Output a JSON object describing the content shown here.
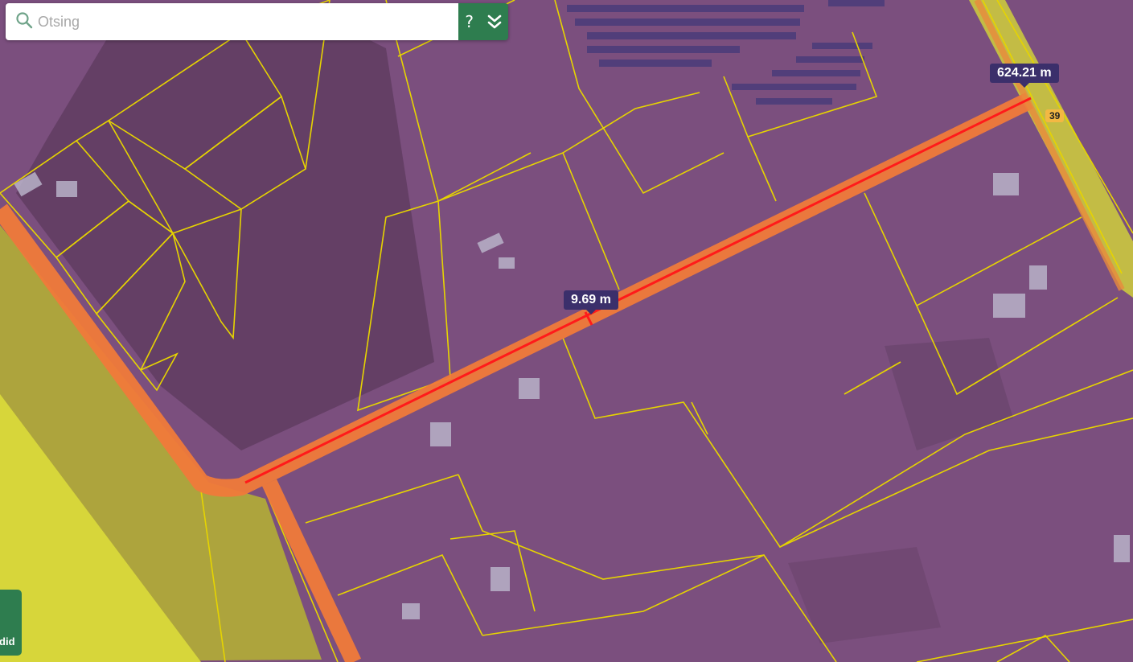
{
  "search": {
    "placeholder": "Otsing",
    "help_label": "?"
  },
  "icons": {
    "search": "search-icon",
    "expand": "double-chevron-down-icon"
  },
  "measurements": {
    "total_length": "624.21 m",
    "width": "9.69 m"
  },
  "road_badge": "39",
  "side_panel": {
    "label": "rdid"
  },
  "colors": {
    "overlay": "#7b4f7e",
    "parcel_outline": "#e6d400",
    "road_fill": "#f07a3a",
    "measure_line": "#ff1a1a",
    "zone_yellow": "#c9c72a",
    "label_bg": "#3b2f6b",
    "accent_green": "#2e7d4f"
  }
}
